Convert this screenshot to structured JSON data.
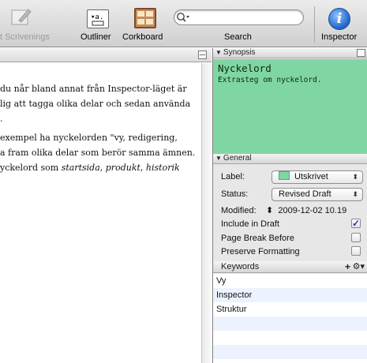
{
  "toolbar": {
    "scrivenings_label": "t Scrivenings",
    "outliner_label": "Outliner",
    "corkboard_label": "Corkboard",
    "search_label": "Search",
    "inspector_label": "Inspector",
    "inspector_glyph": "i"
  },
  "editor": {
    "lines": [
      "du når bland annat från Inspector-läget är",
      "lig att tagga olika delar och sedan använda",
      ".",
      "exempel ha nyckelorden \"vy, redigering,",
      "a fram olika delar som berör samma ämnen.",
      "yckelord som "
    ],
    "line6_italic_1": "startsida",
    "line6_sep_1": ", ",
    "line6_italic_2": "produkt",
    "line6_sep_2": ", ",
    "line6_italic_3": "historik"
  },
  "inspector": {
    "synopsis_header": "Synopsis",
    "synopsis_title": "Nyckelord",
    "synopsis_text": "Extrasteg om nyckelord.",
    "general_header": "General",
    "label_label": "Label:",
    "label_value": "Utskrivet",
    "label_color": "#80d6a2",
    "status_label": "Status:",
    "status_value": "Revised Draft",
    "modified_label": "Modified:",
    "modified_value": "2009-12-02 10.19",
    "include_in_draft_label": "Include in Draft",
    "include_in_draft_checked": true,
    "page_break_label": "Page Break Before",
    "page_break_checked": false,
    "preserve_formatting_label": "Preserve Formatting",
    "preserve_formatting_checked": false,
    "keywords_header": "Keywords",
    "keywords": [
      "Vy",
      "Inspector",
      "Struktur"
    ]
  }
}
